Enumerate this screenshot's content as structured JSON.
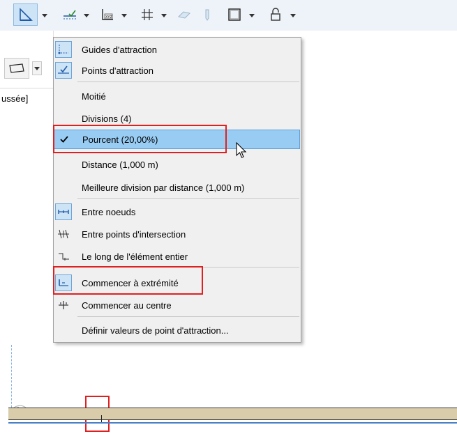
{
  "partial_label": "ussée]",
  "toolbar": {
    "buttons": [
      {
        "icon": "slab-angle-icon"
      },
      {
        "icon": "snap-guide-icon"
      },
      {
        "icon": "xyz-coordinate-icon"
      },
      {
        "icon": "grid-snap-icon"
      },
      {
        "icon": "plane-icon"
      },
      {
        "icon": "pen-icon"
      },
      {
        "icon": "square-frame-icon"
      },
      {
        "icon": "lock-icon"
      }
    ]
  },
  "menu": {
    "items": [
      {
        "label": "Guides d'attraction",
        "icon": "snap-guides-icon",
        "checked": true
      },
      {
        "label": "Points d'attraction",
        "icon": "snap-points-icon",
        "checked": true
      },
      {
        "label": "Moitié"
      },
      {
        "label": "Divisions (4)"
      },
      {
        "label": "Pourcent (20,00%)",
        "checked": true,
        "highlighted": true
      },
      {
        "label": "Distance (1,000 m)"
      },
      {
        "label": "Meilleure division par distance (1,000 m)"
      },
      {
        "label": "Entre noeuds",
        "icon": "between-nodes-icon",
        "checked": true
      },
      {
        "label": "Entre points d'intersection",
        "icon": "between-intersections-icon"
      },
      {
        "label": "Le long de l'élément entier",
        "icon": "along-element-icon"
      },
      {
        "label": "Commencer à extrémité",
        "icon": "start-endpoint-icon",
        "checked": true
      },
      {
        "label": "Commencer au centre",
        "icon": "start-center-icon"
      },
      {
        "label": "Définir valeurs de point d'attraction..."
      }
    ]
  },
  "colors": {
    "highlight": "#99ccf3",
    "callout": "#e02020",
    "beam": "#d8ccaa"
  }
}
